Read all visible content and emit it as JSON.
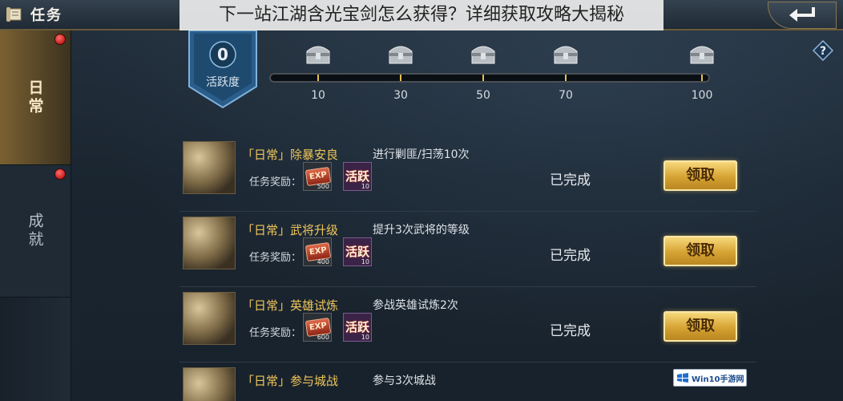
{
  "header": {
    "title": "任务",
    "title_icon": "scroll-icon",
    "back_icon": "back-arrow-icon"
  },
  "banner": {
    "text": "下一站江湖含光宝剑怎么获得？详细获取攻略大揭秘"
  },
  "sidebar": {
    "tabs": [
      {
        "label": "日常",
        "active": true,
        "has_dot": true
      },
      {
        "label": "成就",
        "active": false,
        "has_dot": true
      }
    ]
  },
  "activity": {
    "value": "0",
    "label": "活跃度",
    "progress_fraction": 0,
    "milestones": [
      "10",
      "30",
      "50",
      "70",
      "100"
    ]
  },
  "tasks": [
    {
      "title": "「日常」除暴安良",
      "desc": "进行剿匪/扫荡10次",
      "reward_label": "任务奖励：",
      "exp_qty": "500",
      "huo_label": "活跃",
      "huo_qty": "10",
      "status": "已完成",
      "button": "领取"
    },
    {
      "title": "「日常」武将升级",
      "desc": "提升3次武将的等级",
      "reward_label": "任务奖励：",
      "exp_qty": "400",
      "huo_label": "活跃",
      "huo_qty": "10",
      "status": "已完成",
      "button": "领取"
    },
    {
      "title": "「日常」英雄试炼",
      "desc": "参战英雄试炼2次",
      "reward_label": "任务奖励：",
      "exp_qty": "600",
      "huo_label": "活跃",
      "huo_qty": "10",
      "status": "已完成",
      "button": "领取"
    },
    {
      "title": "「日常」参与城战",
      "desc": "参与3次城战"
    }
  ],
  "exp_label": "EXP",
  "watermark": {
    "text": "Win10手游网"
  },
  "colors": {
    "accent_gold": "#f0c65a",
    "button_gold": "#d6a334",
    "background": "#1b2733"
  }
}
